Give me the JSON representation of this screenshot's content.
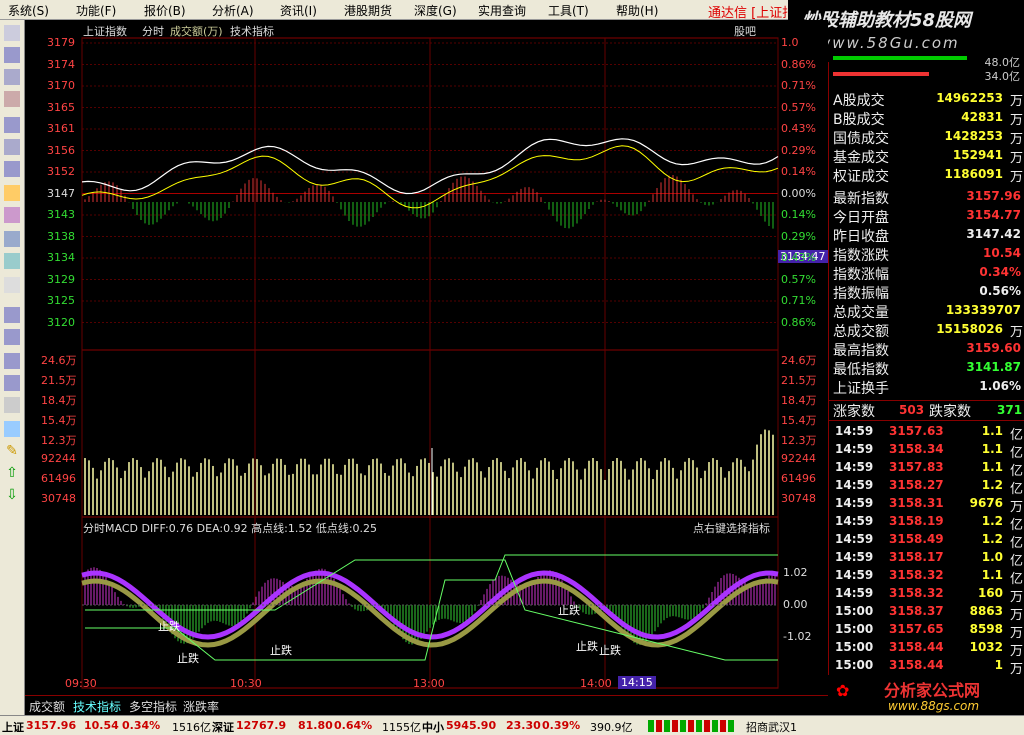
{
  "menu": [
    "系统(S)",
    "功能(F)",
    "报价(B)",
    "分析(A)",
    "资讯(I)",
    "港股期货",
    "深度(G)",
    "实用查询",
    "工具(T)",
    "帮助(H)"
  ],
  "brand": "通达信 [上证指",
  "watermark": {
    "line1": "炒股辅助教材58股网",
    "line2": "www.58Gu.com"
  },
  "header": {
    "title": "上证指数",
    "tab1": "分时",
    "tab2": "成交额(万)",
    "tab3": "技术指标",
    "right": "股吧"
  },
  "price_axis": {
    "left": [
      "3179",
      "3174",
      "3170",
      "3165",
      "3161",
      "3156",
      "3152",
      "3147",
      "3143",
      "3138",
      "3134",
      "3129",
      "3125",
      "3120"
    ],
    "right": [
      "1.0",
      "0.86%",
      "0.71%",
      "0.57%",
      "0.43%",
      "0.29%",
      "0.14%",
      "0.00%",
      "0.14%",
      "0.29%",
      "0.43%",
      "0.57%",
      "0.71%",
      "0.86%"
    ],
    "marker": "3134.47"
  },
  "vol_axis": {
    "labels": [
      "24.6万",
      "21.5万",
      "18.4万",
      "15.4万",
      "12.3万",
      "92244",
      "61496",
      "30748"
    ]
  },
  "macd": {
    "header": "分时MACD  DIFF:0.76  DEA:0.92  高点线:1.52  低点线:0.25",
    "hint": "点右键选择指标",
    "labels": [
      "1.02",
      "0.00",
      "-1.02"
    ],
    "stops": [
      "止跌",
      "止跌",
      "止跌",
      "止跌",
      "止跌",
      "止跌"
    ]
  },
  "time_axis": [
    "09:30",
    "10:30",
    "13:00",
    "14:00"
  ],
  "time_marker": "14:15",
  "tabs": [
    "成交额",
    "技术指标",
    "多空指标",
    "涨跌率"
  ],
  "bars": {
    "v1": "48.0亿",
    "v2": "34.0亿"
  },
  "stats": [
    {
      "label": "A股成交",
      "value": "14962253",
      "unit": "万",
      "color": "#ffff33"
    },
    {
      "label": "B股成交",
      "value": "42831",
      "unit": "万",
      "color": "#ffff33"
    },
    {
      "label": "国债成交",
      "value": "1428253",
      "unit": "万",
      "color": "#ffff33"
    },
    {
      "label": "基金成交",
      "value": "152941",
      "unit": "万",
      "color": "#ffff33"
    },
    {
      "label": "权证成交",
      "value": "1186091",
      "unit": "万",
      "color": "#ffff33"
    }
  ],
  "quotes": [
    {
      "label": "最新指数",
      "value": "3157.96",
      "unit": "",
      "color": "#ff3333"
    },
    {
      "label": "今日开盘",
      "value": "3154.77",
      "unit": "",
      "color": "#ff3333"
    },
    {
      "label": "昨日收盘",
      "value": "3147.42",
      "unit": "",
      "color": "#eeeeee"
    },
    {
      "label": "指数涨跌",
      "value": "10.54",
      "unit": "",
      "color": "#ff3333"
    },
    {
      "label": "指数涨幅",
      "value": "0.34%",
      "unit": "",
      "color": "#ff3333"
    },
    {
      "label": "指数振幅",
      "value": "0.56%",
      "unit": "",
      "color": "#eeeeee"
    },
    {
      "label": "总成交量",
      "value": "133339707",
      "unit": "",
      "color": "#ffff33"
    },
    {
      "label": "总成交额",
      "value": "15158026",
      "unit": "万",
      "color": "#ffff33"
    },
    {
      "label": "最高指数",
      "value": "3159.60",
      "unit": "",
      "color": "#ff3333"
    },
    {
      "label": "最低指数",
      "value": "3141.87",
      "unit": "",
      "color": "#33ff33"
    },
    {
      "label": "上证换手",
      "value": "1.06%",
      "unit": "",
      "color": "#eeeeee"
    }
  ],
  "breadth": {
    "up_label": "涨家数",
    "up": "503",
    "down_label": "跌家数",
    "down": "371"
  },
  "ticks": [
    {
      "t": "14:59",
      "p": "3157.63",
      "v": "1.1",
      "u": "亿"
    },
    {
      "t": "14:59",
      "p": "3158.34",
      "v": "1.1",
      "u": "亿"
    },
    {
      "t": "14:59",
      "p": "3157.83",
      "v": "1.1",
      "u": "亿"
    },
    {
      "t": "14:59",
      "p": "3158.27",
      "v": "1.2",
      "u": "亿"
    },
    {
      "t": "14:59",
      "p": "3158.31",
      "v": "9676",
      "u": "万"
    },
    {
      "t": "14:59",
      "p": "3158.19",
      "v": "1.2",
      "u": "亿"
    },
    {
      "t": "14:59",
      "p": "3158.49",
      "v": "1.2",
      "u": "亿"
    },
    {
      "t": "14:59",
      "p": "3158.17",
      "v": "1.0",
      "u": "亿"
    },
    {
      "t": "14:59",
      "p": "3158.32",
      "v": "1.1",
      "u": "亿"
    },
    {
      "t": "14:59",
      "p": "3158.32",
      "v": "160",
      "u": "万"
    },
    {
      "t": "15:00",
      "p": "3158.37",
      "v": "8863",
      "u": "万"
    },
    {
      "t": "15:00",
      "p": "3157.65",
      "v": "8598",
      "u": "万"
    },
    {
      "t": "15:00",
      "p": "3158.44",
      "v": "1032",
      "u": "万"
    },
    {
      "t": "15:00",
      "p": "3158.44",
      "v": "1",
      "u": "万"
    }
  ],
  "logo2": {
    "line1": "分析家公式网",
    "line2": "www.88gs.com"
  },
  "status": [
    {
      "label": "上证",
      "value": "3157.96",
      "chg": "10.54",
      "pct": "0.34%",
      "amt": "1516亿"
    },
    {
      "label": "深证",
      "value": "12767.9",
      "chg": "81.80",
      "pct": "0.64%",
      "amt": "1155亿"
    },
    {
      "label": "中小",
      "value": "5945.90",
      "chg": "23.30",
      "pct": "0.39%",
      "amt": "390.9亿"
    }
  ],
  "status_right": "招商武汉1"
}
